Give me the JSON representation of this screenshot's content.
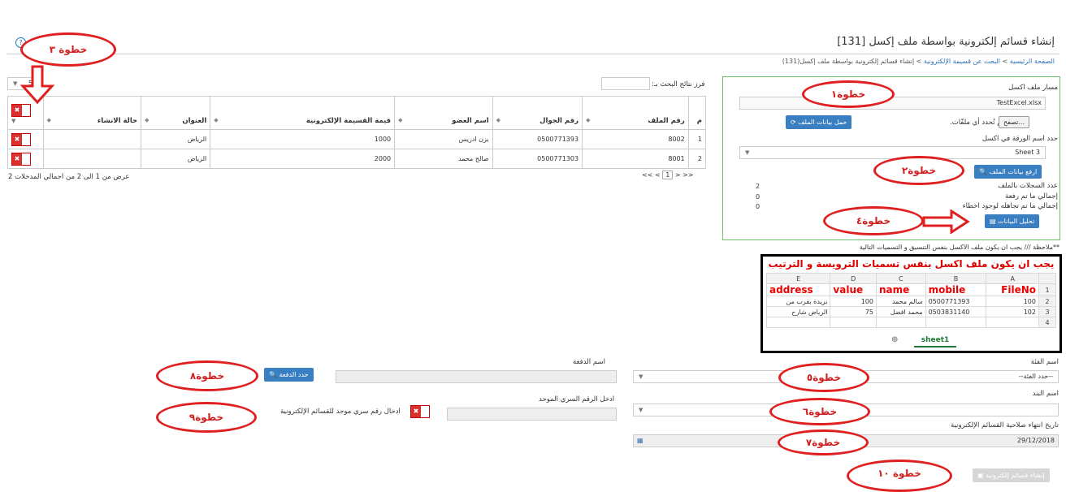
{
  "page": {
    "title": "إنشاء قسائم إلكترونية بواسطة ملف إكسل [131]",
    "breadcrumb": [
      "الصفحة الرئيسية",
      "البحث عن قسيمة الإلكترونية",
      "إنشاء قسائم إلكترونية بواسطة ملف إكسل(131)"
    ],
    "breadcrumb_sep": ">",
    "help_icon": "?"
  },
  "upload_panel": {
    "file_path_label": "مسار ملف اكسل",
    "file_name": "TestExcel.xlsx",
    "browse_label": "تصفح...",
    "no_file_label": "لم تُحدد أي ملفّات.",
    "load_button": "حمل بيانات الملف",
    "sheet_label": "حدد اسم الورقة في اكسل",
    "sheet_value": "Sheet 3",
    "upload_button": "ارفع بيانات الملف",
    "records_label": "عدد السجلات بالملف",
    "records_value": "2",
    "uploaded_label": "إجمالي ما تم رفعة",
    "uploaded_value": "0",
    "ignored_label": "إجمالي ما تم تجاهله لوجود اخطاء",
    "ignored_value": "0",
    "analyze_button": "تحليل البيانات"
  },
  "grid": {
    "page_size": "5",
    "search_label": "فرز نتائج البحث بـ:",
    "search_value": "",
    "columns": [
      "م",
      "رقم الملف",
      "رقم الجوال",
      "اسم العضو",
      "قيمة القسيمة الإلكترونية",
      "العنوان",
      "حالة الانشاء"
    ],
    "rows": [
      {
        "idx": "1",
        "file_no": "8002",
        "mobile": "0500771393",
        "name": "يزن ادريس",
        "value": "1000",
        "address": "الرياض",
        "status": ""
      },
      {
        "idx": "2",
        "file_no": "8001",
        "mobile": "0500771303",
        "name": "صالح محمد",
        "value": "2000",
        "address": "الرياض",
        "status": ""
      }
    ],
    "pager": {
      "first": "<<",
      "prev": "<",
      "current": "1",
      "next": ">",
      "last": ">>"
    },
    "summary": "عرض من 1 الى 2 من اجمالي المدخلات 2"
  },
  "note": "**ملاحظة /// يجب ان يكون ملف الاكسل بنفس التنسيق و التسميات التالية",
  "excel_sample": {
    "header_text": "يجب ان يكون ملف اكسل بنفس تسميات الترويسة و الترتيب",
    "columns": [
      "E",
      "D",
      "C",
      "B",
      "A"
    ],
    "rows": [
      {
        "row": "1",
        "cells": [
          "address",
          "value",
          "name",
          "mobile",
          "FileNo"
        ]
      },
      {
        "row": "2",
        "cells": [
          "بريدة بقرب من",
          "100",
          "سالم محمد",
          "0500771393",
          "100"
        ]
      },
      {
        "row": "3",
        "cells": [
          "الرياض شارح",
          "75",
          "محمد افضل",
          "0503831140",
          "102"
        ]
      },
      {
        "row": "4",
        "cells": [
          "",
          "",
          "",
          "",
          ""
        ]
      }
    ],
    "sheet_tab": "sheet1"
  },
  "form": {
    "category_label": "اسم الفئة",
    "category_value": "--حدد الفئة--",
    "item_label": "اسم البند",
    "item_value": "",
    "expiry_label": "تاريخ انتهاء صلاحية القسائم الإلكترونية",
    "expiry_value": "29/12/2018",
    "batch_label": "اسم الدفعة",
    "batch_value": "",
    "batch_button": "حدد الدفعة",
    "pin_label": "ادخل الرقم السري الموحد",
    "pin_value": "",
    "pin_toggle_label": "ادخال رقم سري موحد للقسائم الإلكترونية",
    "create_button": "إنشاء قسائم إلكترونية"
  },
  "annotations": {
    "step1": "خطوة١",
    "step2": "خطوة٢",
    "step3": "خطوة ٣",
    "step4": "خطوة٤",
    "step5": "خطوة٥",
    "step6": "خطوة٦",
    "step7": "خطوة٧",
    "step8": "خطوة٨",
    "step9": "خطوة٩",
    "step10": "خطوة ١٠"
  },
  "colors": {
    "accent": "#3a7fc1",
    "annotation": "#e02020",
    "panel_border": "#6cbf6c"
  }
}
